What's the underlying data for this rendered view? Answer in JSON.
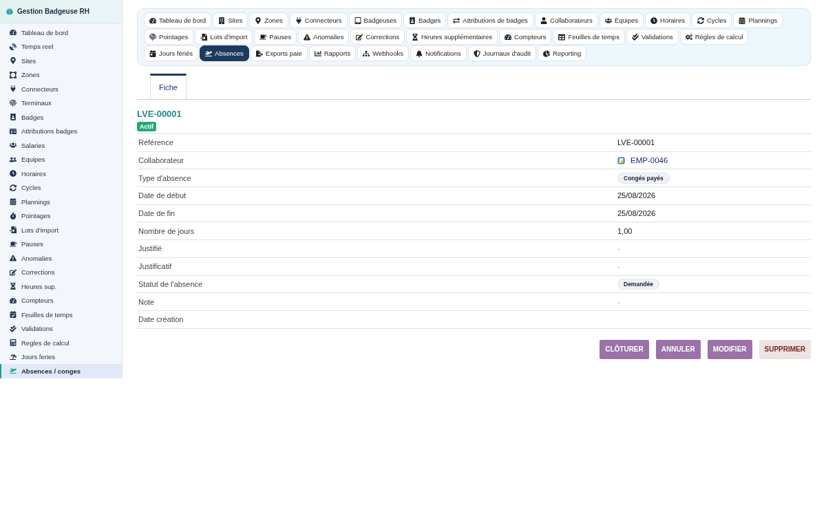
{
  "app": {
    "title": "Gestion Badgeuse RH"
  },
  "sidebar": {
    "items": [
      {
        "label": "Tableau de bord",
        "selected": false
      },
      {
        "label": "Temps reel",
        "selected": false
      },
      {
        "label": "Sites",
        "selected": false
      },
      {
        "label": "Zones",
        "selected": false
      },
      {
        "label": "Connecteurs",
        "selected": false
      },
      {
        "label": "Terminaux",
        "selected": false
      },
      {
        "label": "Badges",
        "selected": false
      },
      {
        "label": "Attributions badges",
        "selected": false
      },
      {
        "label": "Salaries",
        "selected": false
      },
      {
        "label": "Equipes",
        "selected": false
      },
      {
        "label": "Horaires",
        "selected": false
      },
      {
        "label": "Cycles",
        "selected": false
      },
      {
        "label": "Plannings",
        "selected": false
      },
      {
        "label": "Pointages",
        "selected": false
      },
      {
        "label": "Lots d'import",
        "selected": false
      },
      {
        "label": "Pauses",
        "selected": false
      },
      {
        "label": "Anomalies",
        "selected": false
      },
      {
        "label": "Corrections",
        "selected": false
      },
      {
        "label": "Heures sup.",
        "selected": false
      },
      {
        "label": "Compteurs",
        "selected": false
      },
      {
        "label": "Feuilles de temps",
        "selected": false
      },
      {
        "label": "Validations",
        "selected": false
      },
      {
        "label": "Regles de calcul",
        "selected": false
      },
      {
        "label": "Jours feries",
        "selected": false
      },
      {
        "label": "Absences / conges",
        "selected": true
      }
    ]
  },
  "nav": [
    {
      "label": "Tableau de bord",
      "selected": false
    },
    {
      "label": "Sites",
      "selected": false
    },
    {
      "label": "Zones",
      "selected": false
    },
    {
      "label": "Connecteurs",
      "selected": false
    },
    {
      "label": "Badgeuses",
      "selected": false
    },
    {
      "label": "Badges",
      "selected": false
    },
    {
      "label": "Attributions de badges",
      "selected": false
    },
    {
      "label": "Collaborateurs",
      "selected": false
    },
    {
      "label": "Équipes",
      "selected": false
    },
    {
      "label": "Horaires",
      "selected": false
    },
    {
      "label": "Cycles",
      "selected": false
    },
    {
      "label": "Plannings",
      "selected": false
    },
    {
      "label": "Pointages",
      "selected": false
    },
    {
      "label": "Lots d'import",
      "selected": false
    },
    {
      "label": "Pauses",
      "selected": false
    },
    {
      "label": "Anomalies",
      "selected": false
    },
    {
      "label": "Corrections",
      "selected": false
    },
    {
      "label": "Heures supplémentaires",
      "selected": false
    },
    {
      "label": "Compteurs",
      "selected": false
    },
    {
      "label": "Feuilles de temps",
      "selected": false
    },
    {
      "label": "Validations",
      "selected": false
    },
    {
      "label": "Règles de calcul",
      "selected": false
    },
    {
      "label": "Jours fériés",
      "selected": false
    },
    {
      "label": "Absences",
      "selected": true
    },
    {
      "label": "Exports paie",
      "selected": false
    },
    {
      "label": "Rapports",
      "selected": false
    },
    {
      "label": "Webhooks",
      "selected": false
    },
    {
      "label": "Notifications",
      "selected": false
    },
    {
      "label": "Journaux d'audit",
      "selected": false
    },
    {
      "label": "Reporting",
      "selected": false
    }
  ],
  "tabs": [
    {
      "label": "Fiche",
      "selected": true
    }
  ],
  "record": {
    "title": "LVE-00001",
    "status": "Actif"
  },
  "fields": [
    {
      "label": "Référence",
      "kind": "text",
      "value": "LVE-00001"
    },
    {
      "label": "Collaborateur",
      "kind": "link",
      "value": "EMP-0046"
    },
    {
      "label": "Type d'absence",
      "kind": "tag",
      "value": "Congés payés"
    },
    {
      "label": "Date de début",
      "kind": "text",
      "value": "25/08/2026"
    },
    {
      "label": "Date de fin",
      "kind": "text",
      "value": "25/08/2026"
    },
    {
      "label": "Nombre de jours",
      "kind": "text",
      "value": "1,00"
    },
    {
      "label": "Justifié",
      "kind": "muted",
      "value": "-"
    },
    {
      "label": "Justificatif",
      "kind": "muted",
      "value": "-"
    },
    {
      "label": "Statut de l'absence",
      "kind": "tag",
      "value": "Demandée"
    },
    {
      "label": "Note",
      "kind": "muted",
      "value": "-"
    },
    {
      "label": "Date création",
      "kind": "empty"
    }
  ],
  "actions": [
    {
      "label": "CLÔTURER",
      "kind": "primary"
    },
    {
      "label": "ANNULER",
      "kind": "primary"
    },
    {
      "label": "MODIFIER",
      "kind": "primary"
    },
    {
      "label": "SUPPRIMER",
      "kind": "danger"
    }
  ]
}
